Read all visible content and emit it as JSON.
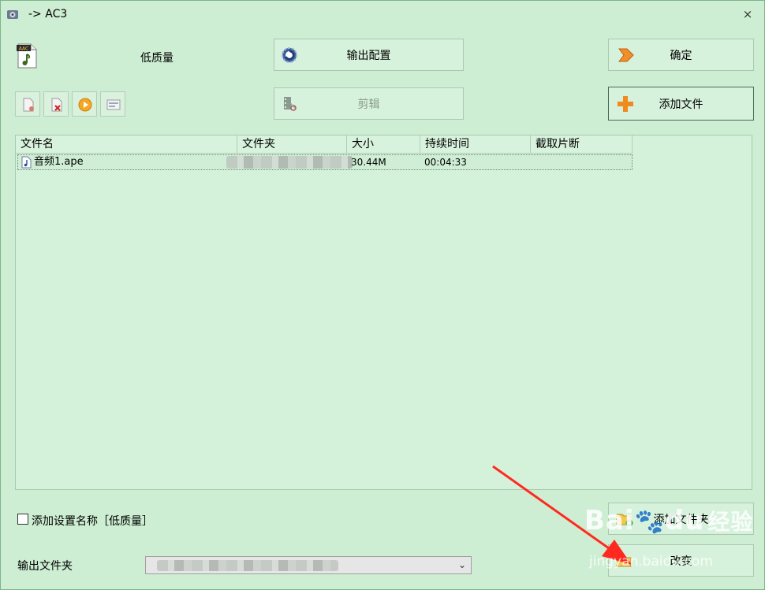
{
  "window": {
    "title": "-> AC3",
    "close_glyph": "×"
  },
  "preset": {
    "label": "低质量",
    "icon": "aac-file-icon",
    "icon_badge": "AAC"
  },
  "buttons": {
    "output_config": "输出配置",
    "ok": "确定",
    "edit": "剪辑",
    "add_file": "添加文件",
    "add_folder": "添加文件夹",
    "change": "改变"
  },
  "toolbar": {
    "items": [
      "remove-file-icon",
      "delete-file-icon",
      "play-icon",
      "info-icon"
    ]
  },
  "file_list": {
    "columns": [
      "文件名",
      "文件夹",
      "大小",
      "持续时间",
      "截取片断"
    ],
    "rows": [
      {
        "name": "音频1.ape",
        "folder": "",
        "size": "30.44M",
        "duration": "00:04:33",
        "clip": ""
      }
    ]
  },
  "options": {
    "add_setting_name_label": "添加设置名称［低质量］",
    "checked": false
  },
  "output": {
    "label": "输出文件夹",
    "value": ""
  },
  "watermark": {
    "brand": "Bai",
    "brand2": "du",
    "brand3": "经验",
    "url": "jingyan.baidu.com"
  },
  "colors": {
    "background": "#cdeed3",
    "accent_plus": "#f08a1c",
    "arrow": "#ff2a1f"
  }
}
